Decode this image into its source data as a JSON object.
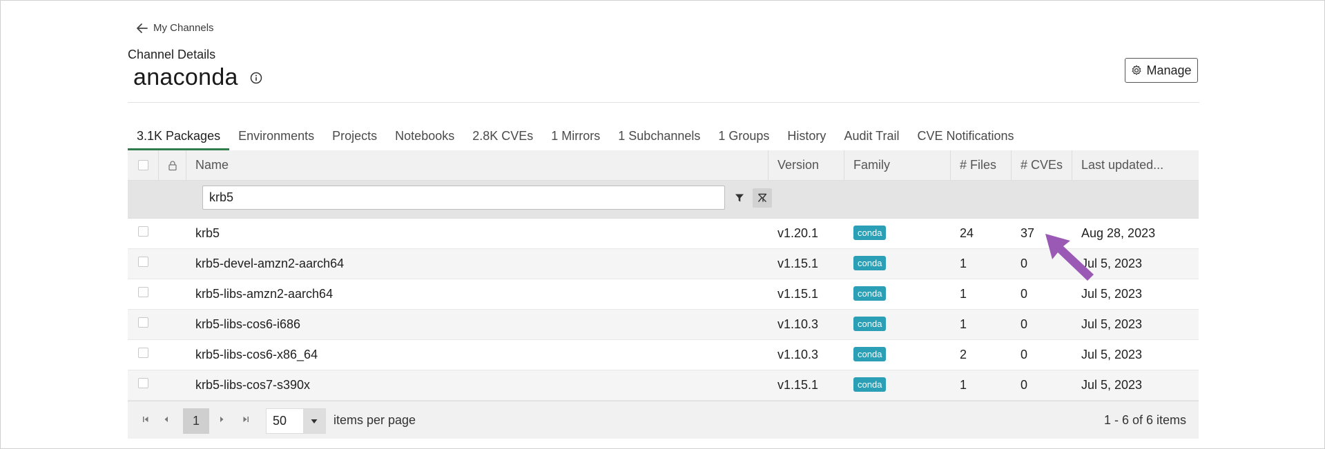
{
  "header": {
    "back_label": "My Channels",
    "breadcrumb": "Channel Details",
    "title": "anaconda",
    "manage_label": "Manage"
  },
  "tabs": [
    {
      "label": "3.1K  Packages",
      "active": true
    },
    {
      "label": "Environments"
    },
    {
      "label": "Projects"
    },
    {
      "label": "Notebooks"
    },
    {
      "label": "2.8K  CVEs"
    },
    {
      "label": "1  Mirrors"
    },
    {
      "label": "1  Subchannels"
    },
    {
      "label": "1  Groups"
    },
    {
      "label": "History"
    },
    {
      "label": "Audit Trail"
    },
    {
      "label": "CVE Notifications"
    }
  ],
  "table": {
    "columns": {
      "name": "Name",
      "version": "Version",
      "family": "Family",
      "files": "# Files",
      "cves": "# CVEs",
      "updated": "Last updated..."
    },
    "filter_value": "krb5",
    "rows": [
      {
        "name": "krb5",
        "version": "v1.20.1",
        "family": "conda",
        "files": "24",
        "cves": "37",
        "updated": "Aug 28, 2023"
      },
      {
        "name": "krb5-devel-amzn2-aarch64",
        "version": "v1.15.1",
        "family": "conda",
        "files": "1",
        "cves": "0",
        "updated": "Jul 5, 2023"
      },
      {
        "name": "krb5-libs-amzn2-aarch64",
        "version": "v1.15.1",
        "family": "conda",
        "files": "1",
        "cves": "0",
        "updated": "Jul 5, 2023"
      },
      {
        "name": "krb5-libs-cos6-i686",
        "version": "v1.10.3",
        "family": "conda",
        "files": "1",
        "cves": "0",
        "updated": "Jul 5, 2023"
      },
      {
        "name": "krb5-libs-cos6-x86_64",
        "version": "v1.10.3",
        "family": "conda",
        "files": "2",
        "cves": "0",
        "updated": "Jul 5, 2023"
      },
      {
        "name": "krb5-libs-cos7-s390x",
        "version": "v1.15.1",
        "family": "conda",
        "files": "1",
        "cves": "0",
        "updated": "Jul 5, 2023"
      }
    ]
  },
  "pager": {
    "current_page": "1",
    "page_size": "50",
    "per_page_label": "items per page",
    "info": "1 - 6 of 6 items"
  },
  "colors": {
    "badge": "#2a9fb5",
    "active_tab": "#2e7d4a",
    "callout_arrow": "#9b59b6"
  }
}
